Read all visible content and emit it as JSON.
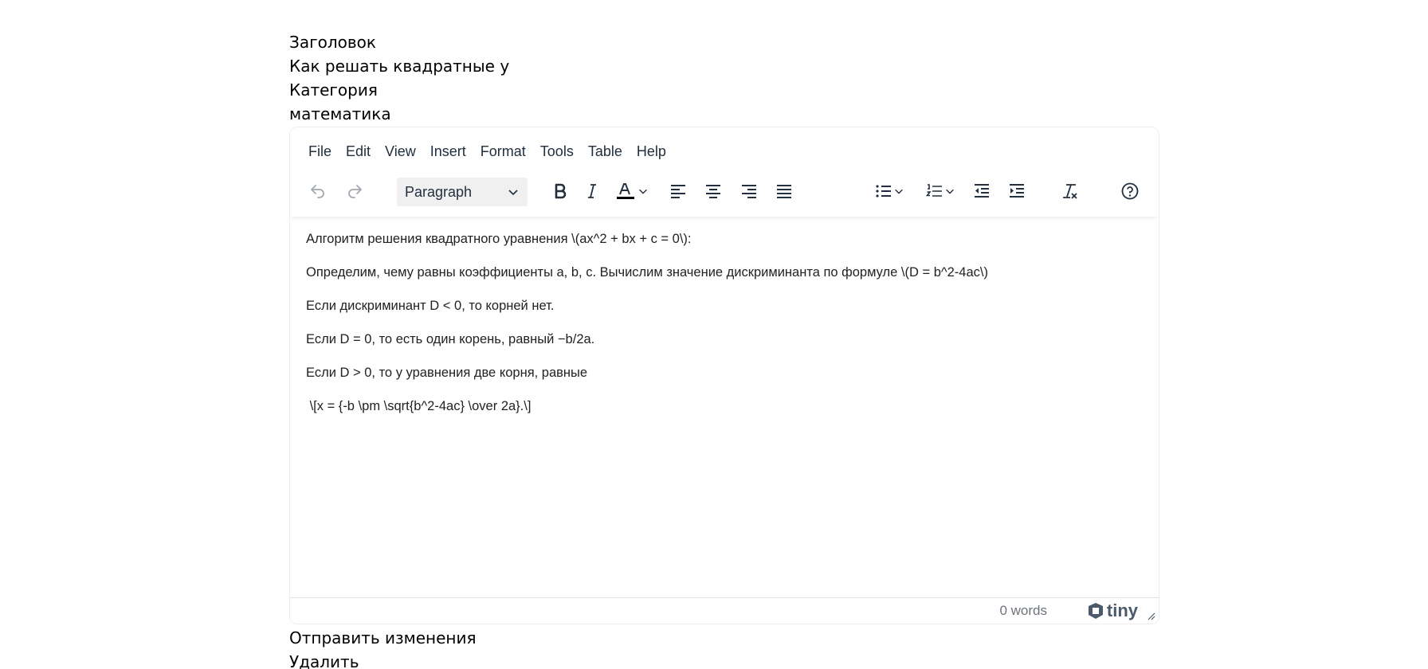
{
  "form": {
    "title_label": "Заголовок",
    "title_value": "Как решать квадратные уравнения",
    "category_label": "Категория",
    "category_value": "математика"
  },
  "editor": {
    "menu": [
      "File",
      "Edit",
      "View",
      "Insert",
      "Format",
      "Tools",
      "Table",
      "Help"
    ],
    "block_format": "Paragraph",
    "toolbar_icons": [
      "undo-icon",
      "redo-icon",
      "bold-icon",
      "italic-icon",
      "text-color-icon",
      "align-left-icon",
      "align-center-icon",
      "align-right-icon",
      "align-justify-icon",
      "bullet-list-icon",
      "numbered-list-icon",
      "outdent-icon",
      "indent-icon",
      "clear-formatting-icon",
      "help-icon"
    ],
    "paragraphs": [
      "Алгоритм решения квадратного уравнения \\(ax^2 + bx + c = 0\\):",
      "Определим, чему равны коэффициенты a, b, c. Вычислим значение дискриминанта по формуле \\(D = b^2-4ac\\)",
      "Если дискриминант D < 0, то корней нет.",
      "Если D = 0, то есть один корень, равный −b/2a.",
      "Если D > 0, то у уравнения две корня, равные",
      " \\[x = {-b \\pm \\sqrt{b^2-4ac} \\over 2a}.\\]"
    ],
    "word_count": "0 words",
    "brand": "tiny"
  },
  "actions": {
    "submit": "Отправить изменения",
    "delete": "Удалить"
  },
  "colors": {
    "text_color_bar": "#000000",
    "icon": "#222f3e",
    "disabled_icon": "#a2a8b0"
  }
}
